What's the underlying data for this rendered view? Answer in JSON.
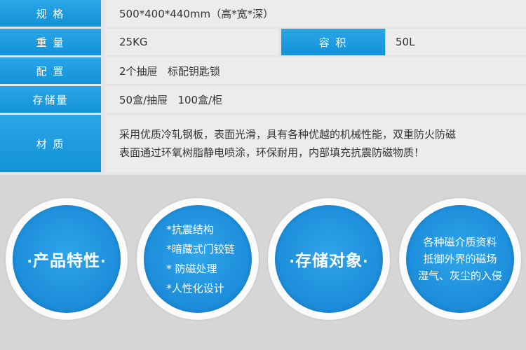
{
  "spec": {
    "size": {
      "label": "规 格",
      "value": "500*400*440mm（高*宽*深）"
    },
    "weight": {
      "label": "重 量",
      "value": "25KG"
    },
    "volume": {
      "label": "容 积",
      "value": "50L"
    },
    "config": {
      "label": "配 置",
      "value": "2个抽屉   标配钥匙锁"
    },
    "storage": {
      "label": "存储量",
      "value": "50盒/抽屉   100盒/柜"
    },
    "material": {
      "label": "材 质",
      "lines": [
        "采用优质冷轧钢板，表面光滑，具有各种优越的机械性能，双重防火防磁",
        "表面通过环氧树脂静电喷涂，环保耐用，内部填充抗震防磁物质！"
      ]
    }
  },
  "features": {
    "product_title": "产品特性",
    "feature_items": [
      "*抗震结构",
      "*暗藏式门铰链",
      "* 防磁处理",
      "*人性化设计"
    ],
    "storage_title": "存储对象",
    "storage_lines": [
      "各种磁介质资料",
      "抵御外界的磁场",
      "湿气、灰尘的入侵"
    ],
    "dot": "·",
    "accent_color": "#1a8ad8"
  }
}
